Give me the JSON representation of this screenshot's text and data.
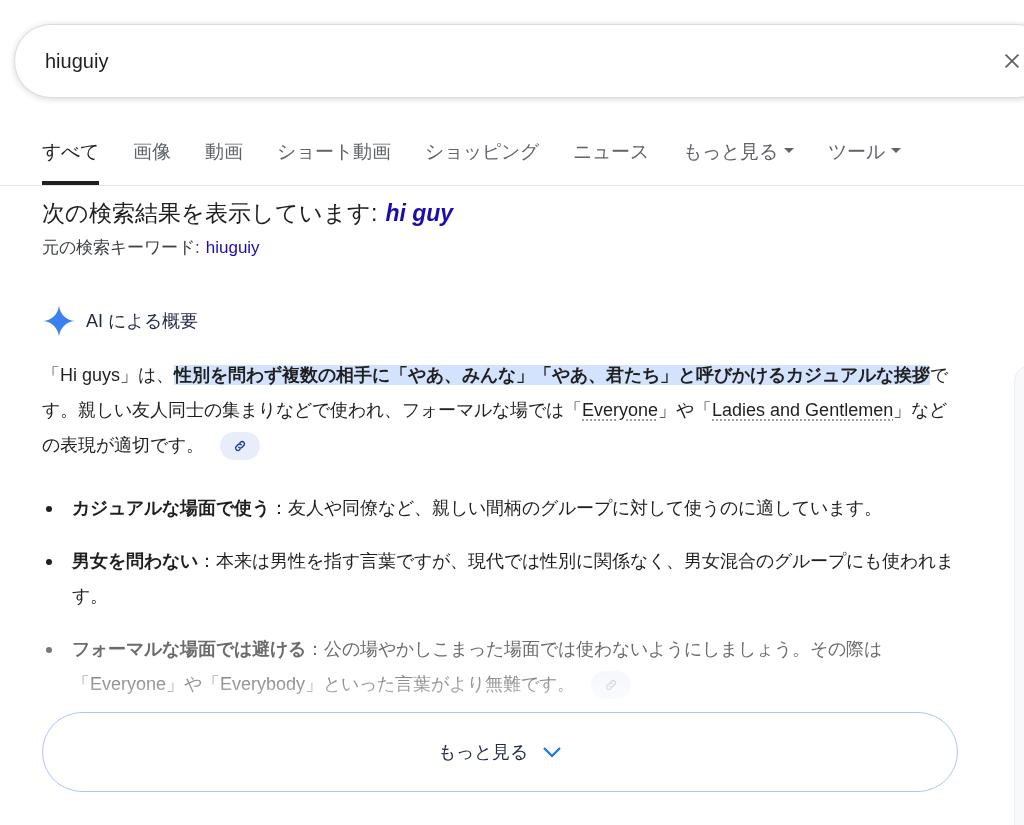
{
  "search": {
    "value": "hiuguiy"
  },
  "tabs": [
    {
      "label": "すべて",
      "selected": true,
      "dropdown": false
    },
    {
      "label": "画像",
      "selected": false,
      "dropdown": false
    },
    {
      "label": "動画",
      "selected": false,
      "dropdown": false
    },
    {
      "label": "ショート動画",
      "selected": false,
      "dropdown": false
    },
    {
      "label": "ショッピング",
      "selected": false,
      "dropdown": false
    },
    {
      "label": "ニュース",
      "selected": false,
      "dropdown": false
    },
    {
      "label": "もっと見る",
      "selected": false,
      "dropdown": true
    },
    {
      "label": "ツール",
      "selected": false,
      "dropdown": true
    }
  ],
  "correction": {
    "label": "次の検索結果を表示しています:",
    "corrected": "hi guy",
    "original_label": "元の検索キーワード:",
    "original": "hiuguiy"
  },
  "ai_overview": {
    "title": "AI による概要",
    "paragraph": [
      {
        "kind": "text",
        "text": "「Hi guys」は、"
      },
      {
        "kind": "highlight",
        "text": "性別を問わず複数の相手に「やあ、みんな」「やあ、君たち」と呼びかけるカジュアルな挨拶"
      },
      {
        "kind": "text",
        "text": "です。親しい友人同士の集まりなどで使われ、フォーマルな場では「"
      },
      {
        "kind": "term",
        "text": "Everyone"
      },
      {
        "kind": "text",
        "text": "」や「"
      },
      {
        "kind": "term",
        "text": "Ladies and Gentlemen"
      },
      {
        "kind": "text",
        "text": "」などの表現が適切です。"
      }
    ],
    "bullets": [
      {
        "heading": "カジュアルな場面で使う",
        "text": "：友人や同僚など、親しい間柄のグループに対して使うのに適しています。",
        "faded": false
      },
      {
        "heading": "男女を問わない",
        "text": "：本来は男性を指す言葉ですが、現代では性別に関係なく、男女混合のグループにも使われます。",
        "faded": false
      },
      {
        "heading": "フォーマルな場面では避ける",
        "text": "：公の場やかしこまった場面では使わないようにしましょう。その際は「Everyone」や「Everybody」といった言葉がより無難です。",
        "faded": true
      }
    ],
    "more_button": "もっと見る"
  }
}
